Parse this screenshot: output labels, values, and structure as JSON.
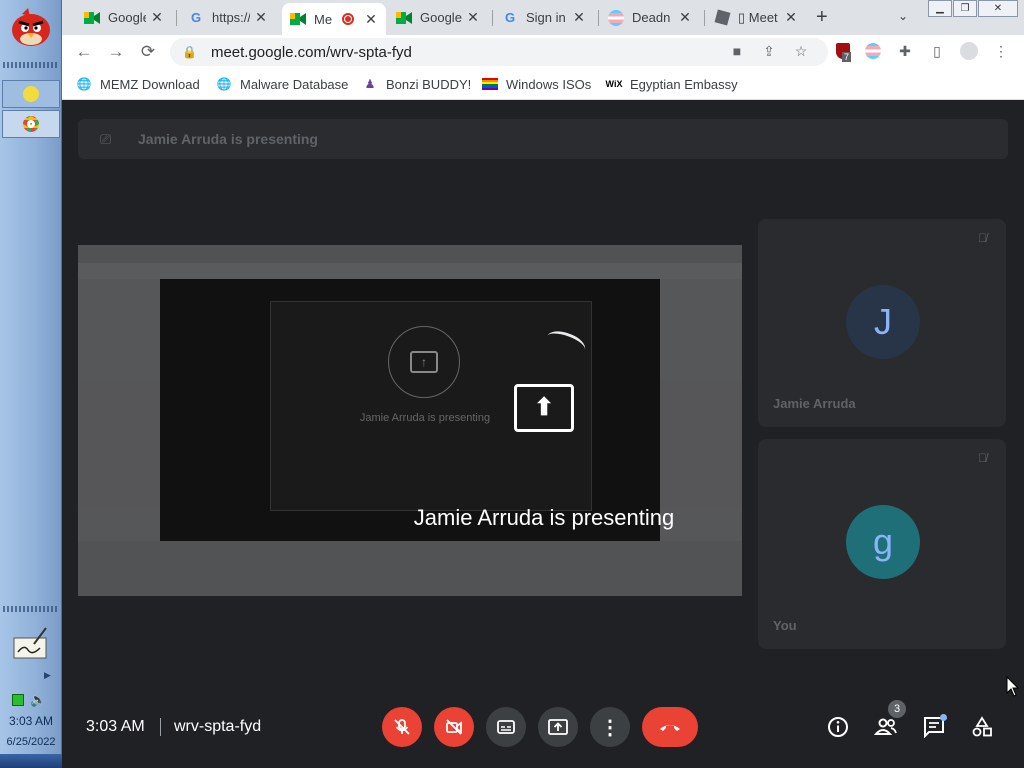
{
  "taskbar": {
    "time": "3:03 AM",
    "date": "6/25/2022",
    "icons": [
      "angry-bird-logo-icon",
      "tab-icon",
      "chrome-icon",
      "signature-icon",
      "network-icon",
      "speaker-icon"
    ]
  },
  "tabs": [
    {
      "title": "Google",
      "icon": "google-meet-icon"
    },
    {
      "title": "https://",
      "icon": "google-icon"
    },
    {
      "title": "Me",
      "icon": "google-meet-icon",
      "active": true,
      "recording": true
    },
    {
      "title": "Google",
      "icon": "google-meet-icon"
    },
    {
      "title": "Sign in",
      "icon": "google-icon"
    },
    {
      "title": "Deadn",
      "icon": "trans-flag-icon"
    },
    {
      "title": "▯ Meet",
      "icon": "roblox-icon"
    }
  ],
  "address_bar": {
    "url": "meet.google.com/wrv-spta-fyd"
  },
  "extension_badge": "7",
  "bookmarks": [
    {
      "label": "MEMZ Download",
      "icon": "globe-icon"
    },
    {
      "label": "Malware Database",
      "icon": "globe-icon"
    },
    {
      "label": "Bonzi BUDDY!",
      "icon": "bonzi-icon"
    },
    {
      "label": "Windows ISOs",
      "icon": "rainbow-flag-icon"
    },
    {
      "label": "Egyptian Embassy",
      "icon": "wix-icon"
    }
  ],
  "meet": {
    "presenting_banner": "Jamie Arruda is presenting",
    "presenting_overlay": "Jamie Arruda is presenting",
    "inner_caption": "Jamie Arruda is presenting",
    "participants": [
      {
        "initial": "J",
        "name": "Jamie Arruda",
        "avatar_color": "#283447"
      },
      {
        "initial": "g",
        "name": "You",
        "avatar_color": "#1f6f78"
      }
    ],
    "time": "3:03 AM",
    "meeting_code": "wrv-spta-fyd",
    "people_count": "3",
    "accent_red": "#ea4335"
  }
}
